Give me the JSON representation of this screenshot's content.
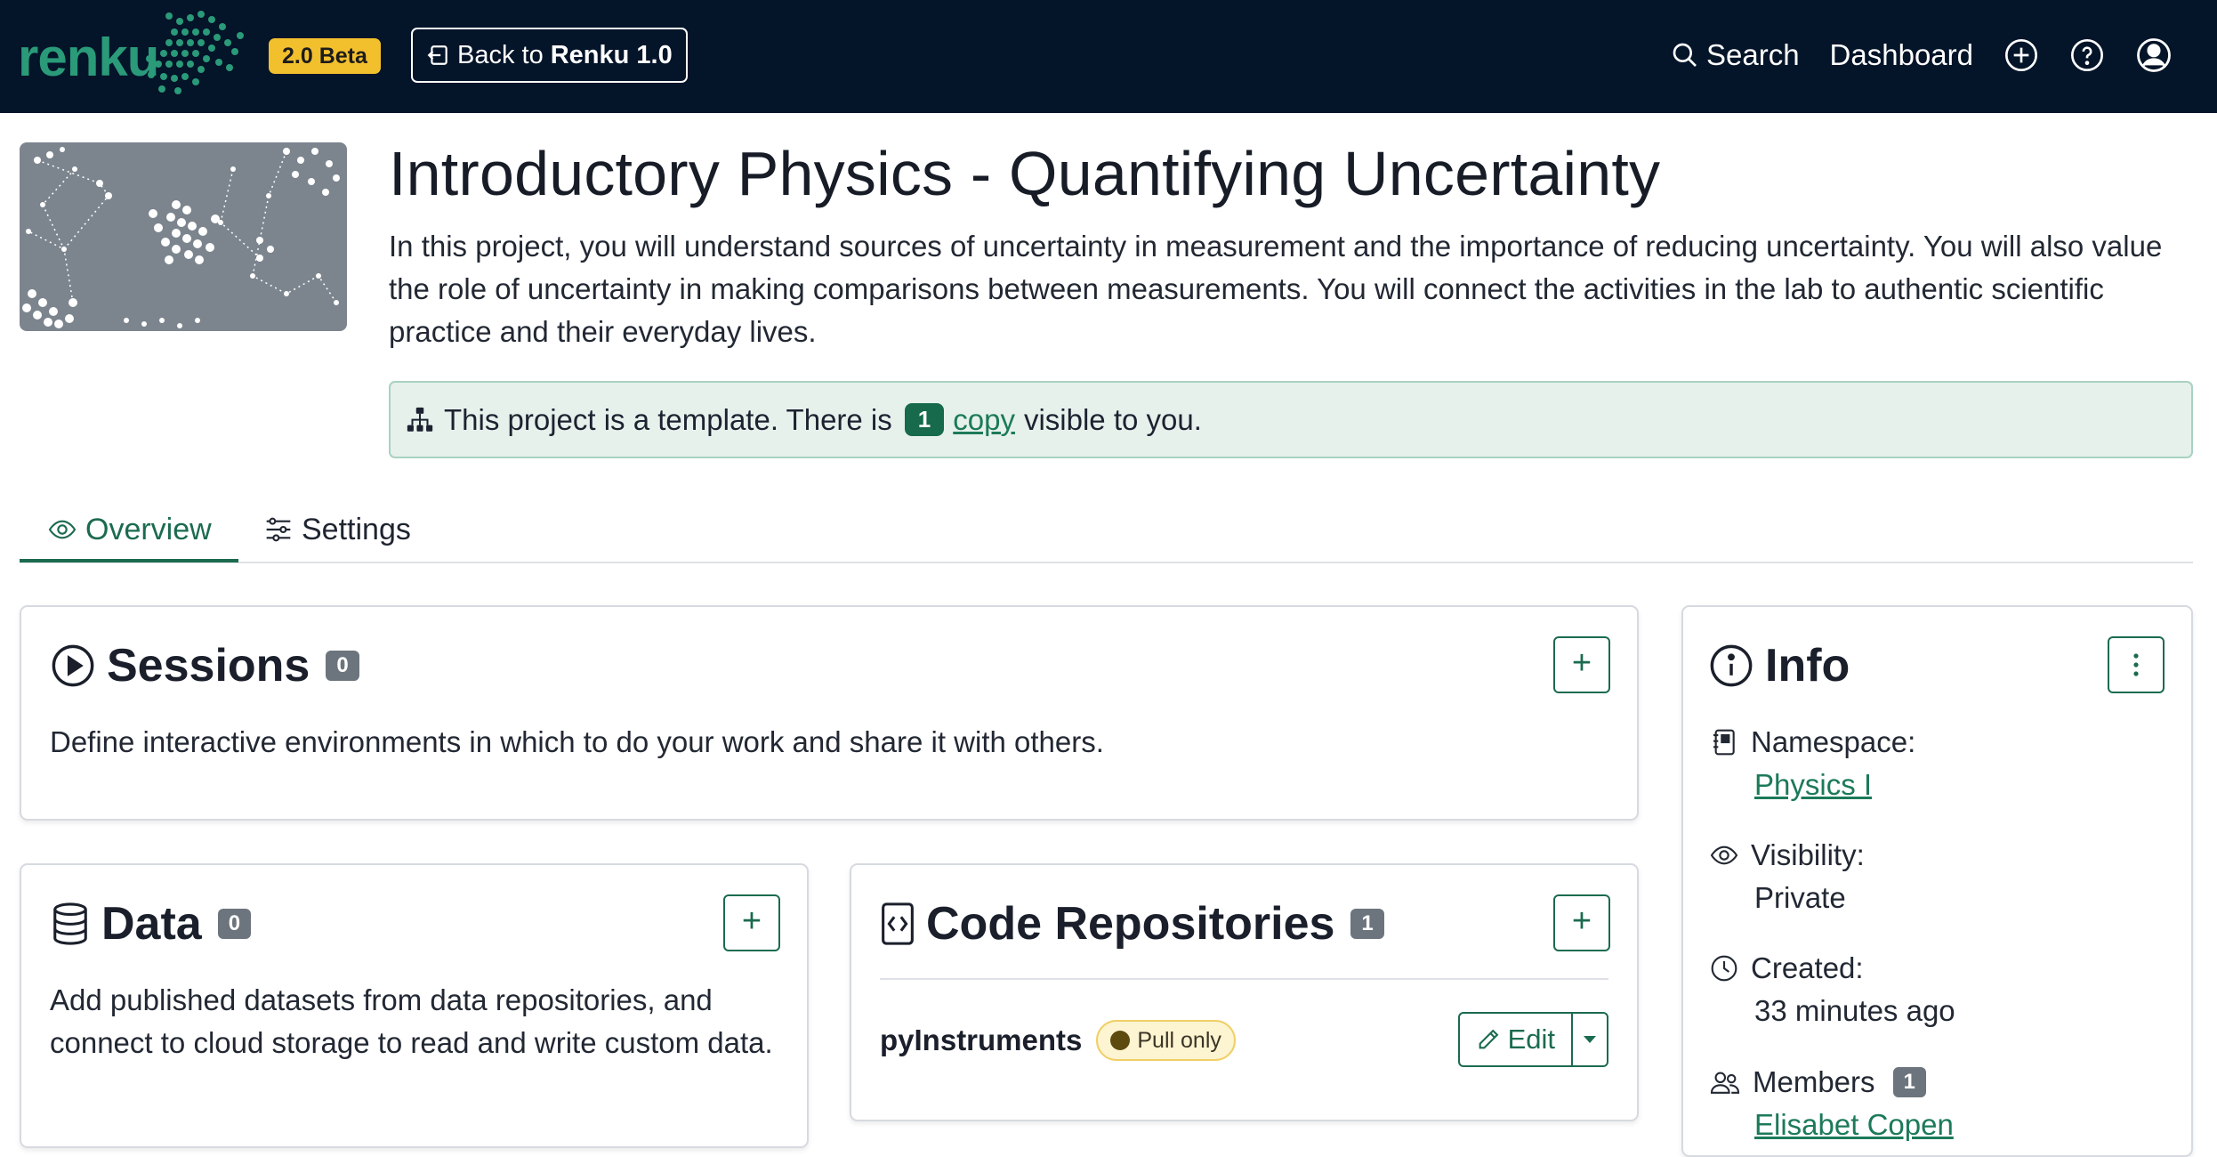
{
  "navbar": {
    "logo_text": "renku",
    "beta_badge": "2.0 Beta",
    "back_button": {
      "prefix": "Back to",
      "bold": "Renku 1.0"
    },
    "search_label": "Search",
    "dashboard_label": "Dashboard",
    "icons": [
      "search-icon",
      "plus-circle-icon",
      "help-circle-icon",
      "user-circle-icon"
    ]
  },
  "project": {
    "title": "Introductory Physics - Quantifying Uncertainty",
    "description": "In this project, you will understand sources of uncertainty in measurement and the importance of reducing uncertainty. You will also value the role of uncertainty in making comparisons between measurements. You will connect the activities in the lab to authentic scientific practice and their everyday lives.",
    "template_notice": {
      "before": "This project is a template. There is",
      "count": "1",
      "link": "copy",
      "after": "visible to you."
    }
  },
  "tabs": [
    {
      "label": "Overview",
      "active": true
    },
    {
      "label": "Settings",
      "active": false
    }
  ],
  "sessions": {
    "title": "Sessions",
    "count": "0",
    "description": "Define interactive environments in which to do your work and share it with others."
  },
  "data": {
    "title": "Data",
    "count": "0",
    "description": "Add published datasets from data repositories, and connect to cloud storage to read and write custom data."
  },
  "code": {
    "title": "Code Repositories",
    "count": "1",
    "repo": {
      "name": "pyInstruments",
      "badge": "Pull only",
      "edit_label": "Edit"
    }
  },
  "info": {
    "title": "Info",
    "namespace_label": "Namespace:",
    "namespace_value": "Physics I",
    "visibility_label": "Visibility:",
    "visibility_value": "Private",
    "created_label": "Created:",
    "created_value": "33 minutes ago",
    "members_label": "Members",
    "members_count": "1",
    "member_name": "Elisabet Copen"
  },
  "colors": {
    "navbar_bg": "#041429",
    "brand_green": "#1b6b4e",
    "logo_green": "#2a9a79",
    "beta_yellow": "#f3c02d",
    "alert_bg": "#e6f1ec",
    "badge_gray": "#6c757d"
  }
}
